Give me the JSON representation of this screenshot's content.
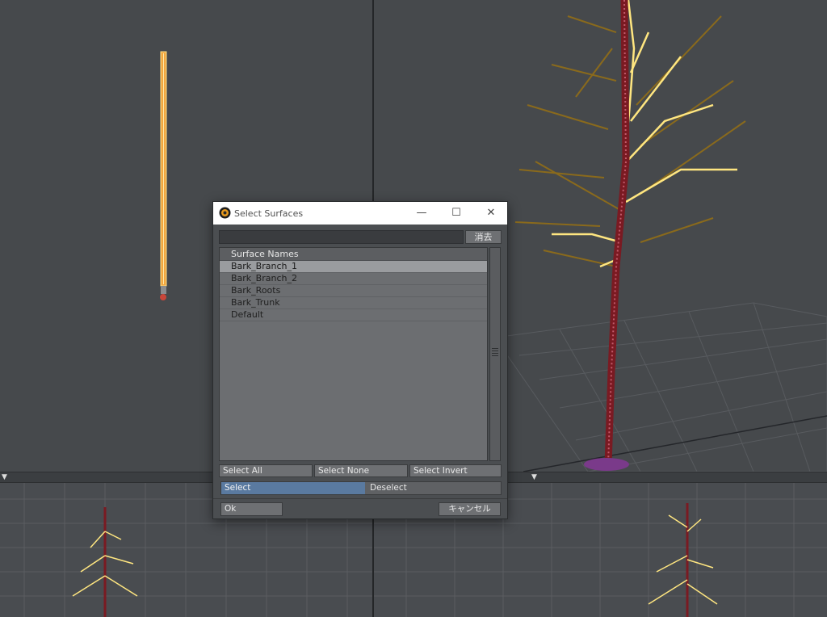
{
  "dialog": {
    "title": "Select Surfaces",
    "clear_label": "消去",
    "filter_value": "",
    "list_header": "Surface Names",
    "surfaces": [
      "Bark_Branch_1",
      "Bark_Branch_2",
      "Bark_Roots",
      "Bark_Trunk",
      "Default"
    ],
    "selected_surface": "Bark_Branch_1",
    "select_all_label": "Select All",
    "select_none_label": "Select None",
    "select_invert_label": "Select Invert",
    "mode_select_label": "Select",
    "mode_deselect_label": "Deselect",
    "active_mode": "Select",
    "ok_label": "Ok",
    "cancel_label": "キャンセル"
  },
  "colors": {
    "branch_highlight": "#ffe680",
    "branch_dim": "#8a6a1c",
    "trunk": "#7a1a22",
    "roots": "#7a3a8a",
    "mode_active": "#5a7aa0"
  },
  "icons": {
    "app": "lightwave-icon",
    "minimize": "minimize-icon",
    "maximize": "maximize-icon",
    "close": "close-icon"
  }
}
